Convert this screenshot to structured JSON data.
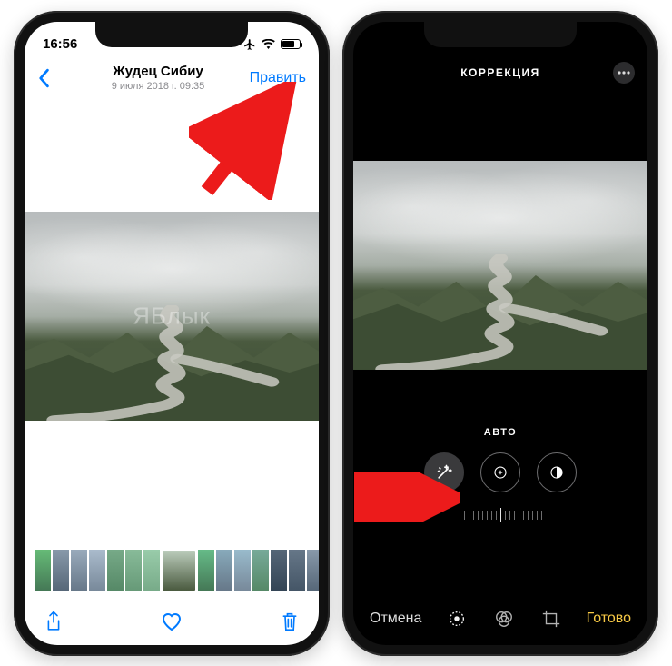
{
  "watermark": "ЯБлык",
  "left": {
    "status": {
      "time": "16:56"
    },
    "nav": {
      "title": "Жудец Сибиу",
      "subtitle": "9 июля 2018 г.  09:35",
      "edit_label": "Править"
    },
    "thumbnails": {
      "count": 16,
      "selected_index": 7
    },
    "toolbar": {
      "share": "share-icon",
      "favorite": "heart-icon",
      "delete": "trash-icon"
    }
  },
  "right": {
    "header": {
      "title": "КОРРЕКЦИЯ"
    },
    "mode_label": "АВТО",
    "dials": [
      {
        "id": "auto",
        "icon": "wand-icon",
        "active": true
      },
      {
        "id": "exposure",
        "icon": "exposure-icon",
        "active": false
      },
      {
        "id": "brilliance",
        "icon": "contrast-icon",
        "active": false
      }
    ],
    "toolbar": {
      "cancel_label": "Отмена",
      "done_label": "Готово",
      "tabs": [
        {
          "id": "adjust",
          "icon": "adjust-icon"
        },
        {
          "id": "filters",
          "icon": "filters-icon"
        },
        {
          "id": "crop",
          "icon": "crop-icon"
        }
      ]
    }
  },
  "colors": {
    "ios_blue": "#007aff",
    "annotation_red": "#ec1b1b"
  }
}
